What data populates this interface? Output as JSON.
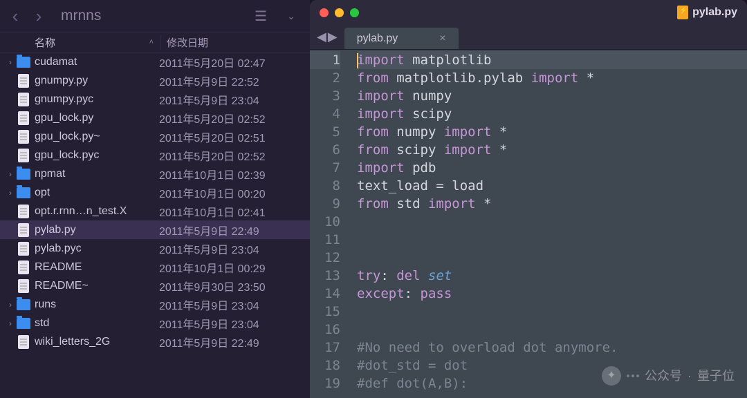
{
  "file_panel": {
    "title": "mrnns",
    "columns": {
      "name": "名称",
      "modified": "修改日期"
    },
    "rows": [
      {
        "kind": "folder",
        "expandable": true,
        "name": "cudamat",
        "date": "2011年5月20日 02:47"
      },
      {
        "kind": "file",
        "expandable": false,
        "name": "gnumpy.py",
        "date": "2011年5月9日 22:52"
      },
      {
        "kind": "file",
        "expandable": false,
        "name": "gnumpy.pyc",
        "date": "2011年5月9日 23:04"
      },
      {
        "kind": "file",
        "expandable": false,
        "name": "gpu_lock.py",
        "date": "2011年5月20日 02:52"
      },
      {
        "kind": "file",
        "expandable": false,
        "name": "gpu_lock.py~",
        "date": "2011年5月20日 02:51"
      },
      {
        "kind": "file",
        "expandable": false,
        "name": "gpu_lock.pyc",
        "date": "2011年5月20日 02:52"
      },
      {
        "kind": "folder",
        "expandable": true,
        "name": "npmat",
        "date": "2011年10月1日 02:39"
      },
      {
        "kind": "folder",
        "expandable": true,
        "name": "opt",
        "date": "2011年10月1日 00:20"
      },
      {
        "kind": "file",
        "expandable": false,
        "name": "opt.r.rnn…n_test.X",
        "date": "2011年10月1日 02:41"
      },
      {
        "kind": "file",
        "expandable": false,
        "name": "pylab.py",
        "date": "2011年5月9日 22:49",
        "selected": true
      },
      {
        "kind": "file",
        "expandable": false,
        "name": "pylab.pyc",
        "date": "2011年5月9日 23:04"
      },
      {
        "kind": "file",
        "expandable": false,
        "name": "README",
        "date": "2011年10月1日 00:29"
      },
      {
        "kind": "file",
        "expandable": false,
        "name": "README~",
        "date": "2011年9月30日 23:50"
      },
      {
        "kind": "folder",
        "expandable": true,
        "name": "runs",
        "date": "2011年5月9日 23:04"
      },
      {
        "kind": "folder",
        "expandable": true,
        "name": "std",
        "date": "2011年5月9日 23:04"
      },
      {
        "kind": "file",
        "expandable": false,
        "name": "wiki_letters_2G",
        "date": "2011年5月9日 22:49"
      }
    ]
  },
  "editor": {
    "title": "pylab.py",
    "tab": "pylab.py",
    "current_line": 1,
    "lines": [
      {
        "n": 1,
        "tokens": [
          [
            "kw-import",
            "import"
          ],
          [
            "ident",
            " matplotlib"
          ]
        ]
      },
      {
        "n": 2,
        "tokens": [
          [
            "kw-from",
            "from"
          ],
          [
            "ident",
            " matplotlib.pylab "
          ],
          [
            "kw-import",
            "import"
          ],
          [
            "op",
            " *"
          ]
        ]
      },
      {
        "n": 3,
        "tokens": [
          [
            "kw-import",
            "import"
          ],
          [
            "ident",
            " numpy"
          ]
        ]
      },
      {
        "n": 4,
        "tokens": [
          [
            "kw-import",
            "import"
          ],
          [
            "ident",
            " scipy"
          ]
        ]
      },
      {
        "n": 5,
        "tokens": [
          [
            "kw-from",
            "from"
          ],
          [
            "ident",
            " numpy "
          ],
          [
            "kw-import",
            "import"
          ],
          [
            "op",
            " *"
          ]
        ]
      },
      {
        "n": 6,
        "tokens": [
          [
            "kw-from",
            "from"
          ],
          [
            "ident",
            " scipy "
          ],
          [
            "kw-import",
            "import"
          ],
          [
            "op",
            " *"
          ]
        ]
      },
      {
        "n": 7,
        "tokens": [
          [
            "kw-import",
            "import"
          ],
          [
            "ident",
            " pdb"
          ]
        ]
      },
      {
        "n": 8,
        "tokens": [
          [
            "ident",
            "text_load "
          ],
          [
            "op",
            "="
          ],
          [
            "ident",
            " load"
          ]
        ]
      },
      {
        "n": 9,
        "tokens": [
          [
            "kw-from",
            "from"
          ],
          [
            "ident",
            " std "
          ],
          [
            "kw-import",
            "import"
          ],
          [
            "op",
            " *"
          ]
        ]
      },
      {
        "n": 10,
        "tokens": []
      },
      {
        "n": 11,
        "tokens": []
      },
      {
        "n": 12,
        "tokens": []
      },
      {
        "n": 13,
        "tokens": [
          [
            "kw-try",
            "try"
          ],
          [
            "op",
            ": "
          ],
          [
            "kw-del",
            "del"
          ],
          [
            "ident",
            " "
          ],
          [
            "special",
            "set"
          ]
        ]
      },
      {
        "n": 14,
        "tokens": [
          [
            "kw-except",
            "except"
          ],
          [
            "op",
            ": "
          ],
          [
            "kw-pass",
            "pass"
          ]
        ]
      },
      {
        "n": 15,
        "tokens": []
      },
      {
        "n": 16,
        "tokens": []
      },
      {
        "n": 17,
        "tokens": [
          [
            "comment",
            "#No need to overload dot anymore."
          ]
        ]
      },
      {
        "n": 18,
        "tokens": [
          [
            "comment",
            "#dot_std = dot"
          ]
        ]
      },
      {
        "n": 19,
        "tokens": [
          [
            "comment",
            "#def dot(A,B):"
          ]
        ]
      }
    ]
  },
  "watermark": {
    "label": "公众号",
    "name": "量子位"
  }
}
